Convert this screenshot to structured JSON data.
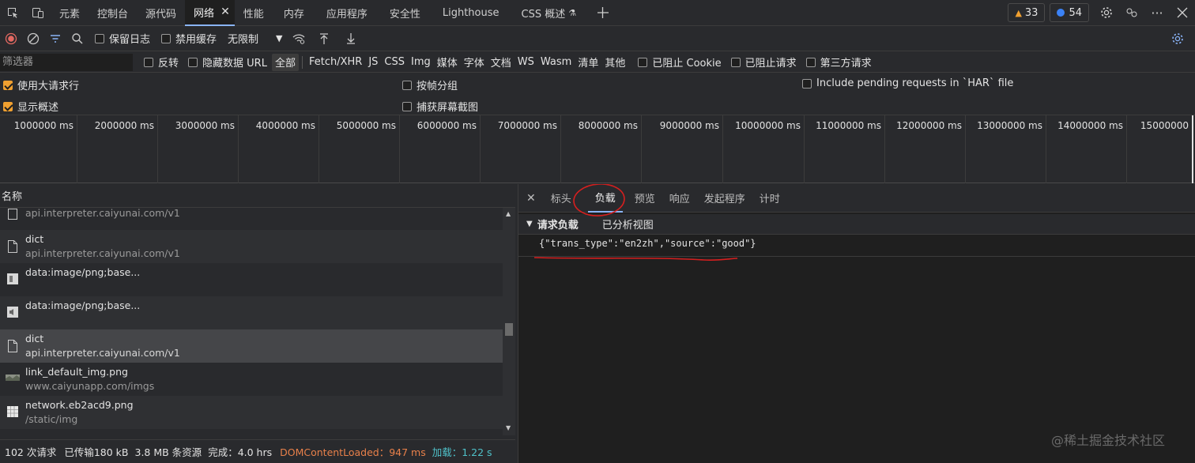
{
  "tabs": {
    "items": [
      "元素",
      "控制台",
      "源代码",
      "网络",
      "性能",
      "内存",
      "应用程序",
      "安全性",
      "Lighthouse",
      "CSS 概述"
    ],
    "active_index": 3,
    "warnings": "33",
    "messages": "54",
    "more": "···"
  },
  "toolbar": {
    "preserve_log": "保留日志",
    "disable_cache": "禁用缓存",
    "throttle": "无限制"
  },
  "filter": {
    "placeholder": "筛选器",
    "invert": "反转",
    "hide_data_url": "隐藏数据 URL",
    "types": [
      "全部",
      "Fetch/XHR",
      "JS",
      "CSS",
      "Img",
      "媒体",
      "字体",
      "文档",
      "WS",
      "Wasm",
      "清单",
      "其他"
    ],
    "blocked_cookies": "已阻止 Cookie",
    "blocked_requests": "已阻止请求",
    "third_party": "第三方请求"
  },
  "options": {
    "big_rows": "使用大请求行",
    "group_by_frame": "按帧分组",
    "pending_har": "Include pending requests in `HAR` file",
    "show_overview": "显示概述",
    "capture_screenshots": "捕获屏幕截图"
  },
  "timeline": {
    "ticks": [
      "1000000 ms",
      "2000000 ms",
      "3000000 ms",
      "4000000 ms",
      "5000000 ms",
      "6000000 ms",
      "7000000 ms",
      "8000000 ms",
      "9000000 ms",
      "10000000 ms",
      "11000000 ms",
      "12000000 ms",
      "13000000 ms",
      "14000000 ms",
      "15000000"
    ]
  },
  "list": {
    "header": "名称",
    "rows": [
      {
        "name": "",
        "url": "api.interpreter.caiyunai.com/v1",
        "icon": "checkbox-icon"
      },
      {
        "name": "dict",
        "url": "api.interpreter.caiyunai.com/v1",
        "icon": "document-icon"
      },
      {
        "name": "data:image/png;base...",
        "url": "",
        "icon": "image-icon"
      },
      {
        "name": "data:image/png;base...",
        "url": "",
        "icon": "audio-icon"
      },
      {
        "name": "dict",
        "url": "api.interpreter.caiyunai.com/v1",
        "icon": "document-icon",
        "selected": true
      },
      {
        "name": "link_default_img.png",
        "url": "www.caiyunapp.com/imgs",
        "icon": "thumbnail-icon"
      },
      {
        "name": "network.eb2acd9.png",
        "url": "/static/img",
        "icon": "grid-image-icon"
      }
    ]
  },
  "detail": {
    "tabs": [
      "标头",
      "负载",
      "预览",
      "响应",
      "发起程序",
      "计时"
    ],
    "active_index": 1,
    "section_title": "请求负载",
    "view_source": "已分析视图",
    "payload": "{\"trans_type\":\"en2zh\",\"source\":\"good\"}"
  },
  "status": {
    "requests": "102 次请求",
    "transferred": "已传输180 kB",
    "resources": "3.8 MB 条资源",
    "finish": "完成：4.0 hrs",
    "dcl": "DOMContentLoaded：947 ms",
    "load": "加载：1.22 s"
  },
  "colors": {
    "accent": "#8ab4f8",
    "warning": "#f0a030",
    "dcl": "#e8804a",
    "load": "#4fc1c9",
    "annotation": "#d61f1f"
  },
  "watermark": "@稀土掘金技术社区"
}
